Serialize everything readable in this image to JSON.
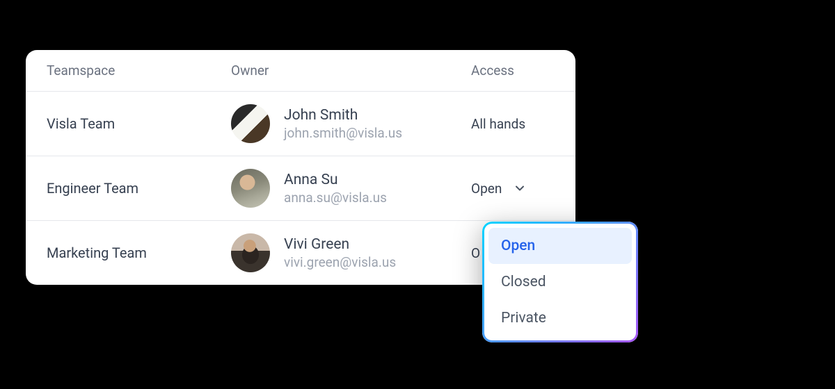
{
  "table": {
    "headers": {
      "teamspace": "Teamspace",
      "owner": "Owner",
      "access": "Access"
    },
    "rows": [
      {
        "teamspace": "Visla Team",
        "owner_name": "John Smith",
        "owner_email": "john.smith@visla.us",
        "access": "All hands",
        "has_dropdown": false
      },
      {
        "teamspace": "Engineer Team",
        "owner_name": "Anna Su",
        "owner_email": "anna.su@visla.us",
        "access": "Open",
        "has_dropdown": true
      },
      {
        "teamspace": "Marketing Team",
        "owner_name": "Vivi Green",
        "owner_email": "vivi.green@visla.us",
        "access": "O",
        "has_dropdown": false
      }
    ]
  },
  "dropdown": {
    "options": [
      "Open",
      "Closed",
      "Private"
    ],
    "selected": "Open"
  }
}
